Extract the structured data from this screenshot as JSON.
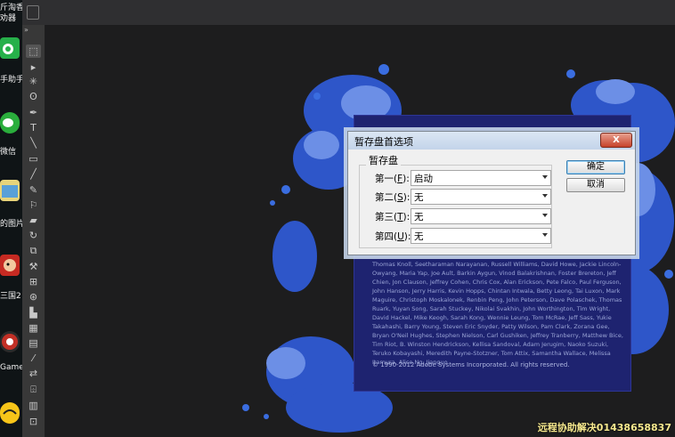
{
  "desktop": {
    "items": [
      {
        "label_top": "斤淘香",
        "label_bottom": "劝器"
      },
      {
        "label": "手助手"
      },
      {
        "label": "微信"
      },
      {
        "label": "的图片"
      },
      {
        "label": "三国2"
      },
      {
        "label": "Game"
      }
    ]
  },
  "tools": [
    "move",
    "marquee",
    "lasso",
    "quick-select",
    "crop",
    "eyedropper",
    "type",
    "line",
    "rectangle",
    "brush",
    "clone",
    "eraser",
    "gradient",
    "blur",
    "dodge",
    "pen",
    "path-select",
    "hand",
    "zoom"
  ],
  "splash": {
    "credits": "Thomas Knoll, Seetharaman Narayanan, Russell Williams, David Howe, Jackie Lincoln-Owyang, Maria Yap, Joe Ault, Barkin Aygun, Vinod Balakrishnan, Foster Brereton, Jeff Chien, Jon Clauson, Jeffrey Cohen, Chris Cox, Alan Erickson, Pete Falco, Paul Ferguson, John Hanson, Jerry Harris, Kevin Hopps, Chintan Intwala, Betty Leong, Tai Luxon, Mark Maguire, Christoph Moskalonek, Renbin Peng, John Peterson, Dave Polaschek, Thomas Ruark, Yuyan Song, Sarah Stuckey, Nikolai Svakhin, John Worthington, Tim Wright, David Hackel, Mike Keogh, Sarah Kong, Wennie Leung, Tom McRae, Jeff Sass, Yukie Takahashi, Barry Young, Steven Eric Snyder, Patty Wilson, Pam Clark, Zorana Gee, Bryan O'Neil Hughes, Stephen Nielson, Carl Gushiken, Jeffrey Tranberry, Matthew Bice, Tim Riot, B. Winston Hendrickson, Kellisa Sandoval, Adam Jerugim, Naoko Suzuki, Teruko Kobayashi, Meredith Payne-Stotzner, Tom Attix, Samantha Wallace, Melissa Itamura, Alice Ng, Jianguo",
    "copyright": "© 1990-2012 Adobe Systems Incorporated. All rights reserved."
  },
  "dialog": {
    "title": "暂存盘首选项",
    "close": "X",
    "group_label": "暂存盘",
    "rows": [
      {
        "label_pre": "第一(",
        "key": "F",
        "label_post": "):",
        "value": "启动"
      },
      {
        "label_pre": "第二(",
        "key": "S",
        "label_post": "):",
        "value": "无"
      },
      {
        "label_pre": "第三(",
        "key": "T",
        "label_post": "):",
        "value": "无"
      },
      {
        "label_pre": "第四(",
        "key": "U",
        "label_post": "):",
        "value": "无"
      }
    ],
    "ok_label": "确定",
    "cancel_label": "取消"
  },
  "overlay": {
    "remote_text": "远程协助解决01438658837"
  },
  "colors": {
    "splash_bg": "#1e2370",
    "ink_blue": "#2e56c9",
    "ink_light": "#6c8fe6"
  }
}
